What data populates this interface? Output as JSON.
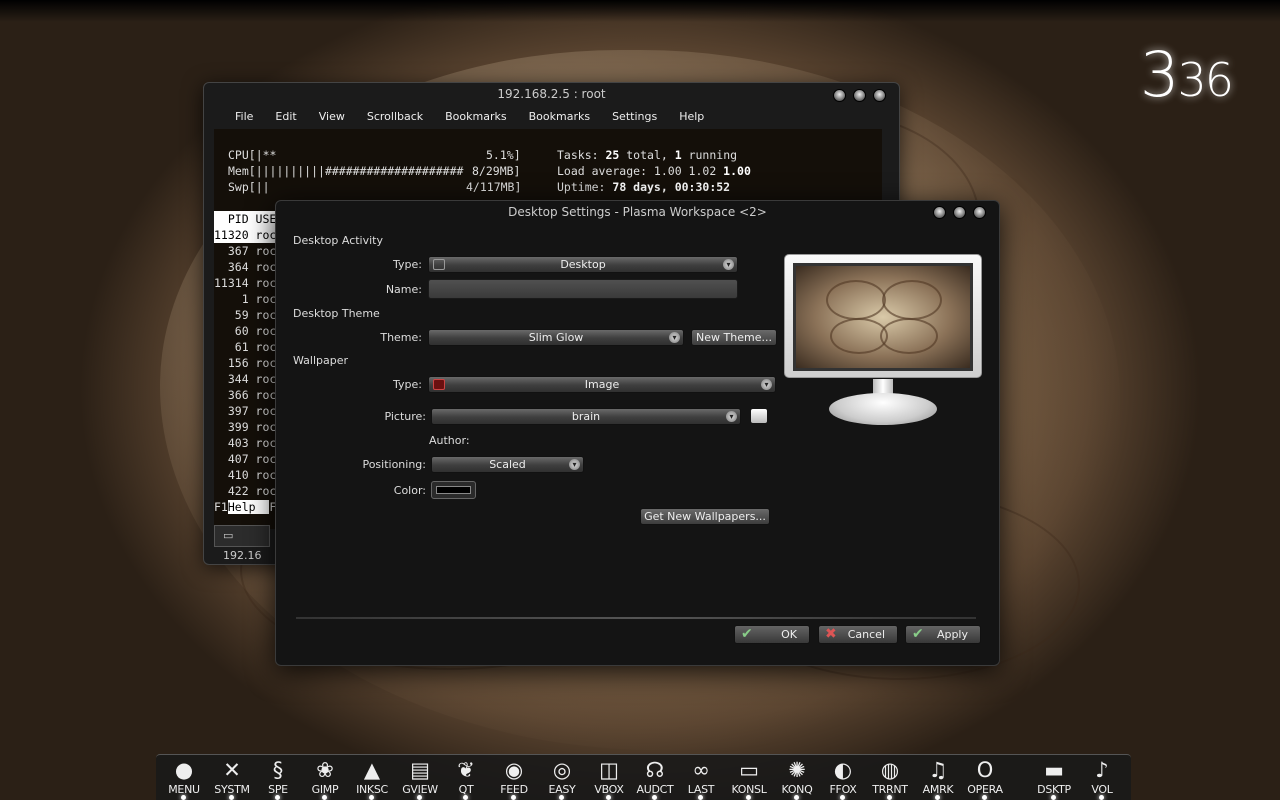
{
  "clock": {
    "hours": "3",
    "minutes": "36"
  },
  "konsole": {
    "title": "192.168.2.5 : root",
    "menu": [
      "File",
      "Edit",
      "View",
      "Scrollback",
      "Bookmarks",
      "Bookmarks",
      "Settings",
      "Help"
    ],
    "htop": {
      "cpu_label": "CPU",
      "cpu_bar": "[|**",
      "cpu_pct": "5.1%]",
      "mem_label": "Mem",
      "mem_bar": "[||||||||||####################",
      "mem_val": "8/29MB]",
      "swp_label": "Swp",
      "swp_bar": "[||",
      "swp_val": "4/117MB]",
      "tasks_label": "Tasks: ",
      "tasks_total": "25",
      "tasks_mid": " total, ",
      "tasks_running": "1",
      "tasks_end": " running",
      "load_label": "Load average: 1.00 1.02 ",
      "load_last": "1.00",
      "uptime_label": "Uptime: ",
      "uptime_val": "78 days, 00:30:52",
      "header": "  PID USE",
      "rows": [
        "11320 roc",
        "  367 roc",
        "  364 roc",
        "11314 roc",
        "    1 roc",
        "   59 roc",
        "   60 roc",
        "   61 roc",
        "  156 roc",
        "  344 roc",
        "  366 roc",
        "  397 roc",
        "  399 roc",
        "  403 roc",
        "  407 roc",
        "  410 roc",
        "  422 roc"
      ],
      "fkey": "F1",
      "fkey_label": "Help  ",
      "fkey_next": "F"
    },
    "tab_label": "192.16"
  },
  "dialog": {
    "title": "Desktop Settings - Plasma Workspace <2>",
    "activity": {
      "section": "Desktop Activity",
      "type_label": "Type:",
      "type_value": "Desktop",
      "name_label": "Name:",
      "name_value": ""
    },
    "theme": {
      "section": "Desktop Theme",
      "theme_label": "Theme:",
      "theme_value": "Slim Glow",
      "new_theme": "New Theme..."
    },
    "wallpaper": {
      "section": "Wallpaper",
      "type_label": "Type:",
      "type_value": "Image",
      "picture_label": "Picture:",
      "picture_value": "brain",
      "author_label": "Author:",
      "positioning_label": "Positioning:",
      "positioning_value": "Scaled",
      "color_label": "Color:",
      "get_new": "Get New Wallpapers..."
    },
    "buttons": {
      "ok": "OK",
      "cancel": "Cancel",
      "apply": "Apply"
    }
  },
  "dock": [
    {
      "label": "MENU",
      "icon": "menu-icon",
      "glyph": "●"
    },
    {
      "label": "SYSTM",
      "icon": "tools-icon",
      "glyph": "✕"
    },
    {
      "label": "SPE",
      "icon": "python-icon",
      "glyph": "§"
    },
    {
      "label": "GIMP",
      "icon": "gimp-icon",
      "glyph": "❀"
    },
    {
      "label": "INKSC",
      "icon": "inkscape-icon",
      "glyph": "▲"
    },
    {
      "label": "GVIEW",
      "icon": "gview-icon",
      "glyph": "▤"
    },
    {
      "label": "QT",
      "icon": "qt-icon",
      "glyph": "❦"
    },
    {
      "label": "FEED",
      "icon": "rss-icon",
      "glyph": "◉"
    },
    {
      "label": "EASY",
      "icon": "disc-icon",
      "glyph": "◎"
    },
    {
      "label": "VBOX",
      "icon": "vbox-icon",
      "glyph": "◫"
    },
    {
      "label": "AUDCT",
      "icon": "headphones-icon",
      "glyph": "☊"
    },
    {
      "label": "LAST",
      "icon": "lastfm-icon",
      "glyph": "∞"
    },
    {
      "label": "KONSL",
      "icon": "terminal-icon",
      "glyph": "▭"
    },
    {
      "label": "KONQ",
      "icon": "konqueror-icon",
      "glyph": "✺"
    },
    {
      "label": "FFOX",
      "icon": "firefox-icon",
      "glyph": "◐"
    },
    {
      "label": "TRRNT",
      "icon": "torrent-icon",
      "glyph": "◍"
    },
    {
      "label": "AMRK",
      "icon": "amarok-icon",
      "glyph": "♫"
    },
    {
      "label": "OPERA",
      "icon": "opera-icon",
      "glyph": "O"
    },
    {
      "label": "DSKTP",
      "icon": "desktop-icon",
      "glyph": "▬"
    },
    {
      "label": "VOL",
      "icon": "volume-icon",
      "glyph": "♪"
    }
  ]
}
